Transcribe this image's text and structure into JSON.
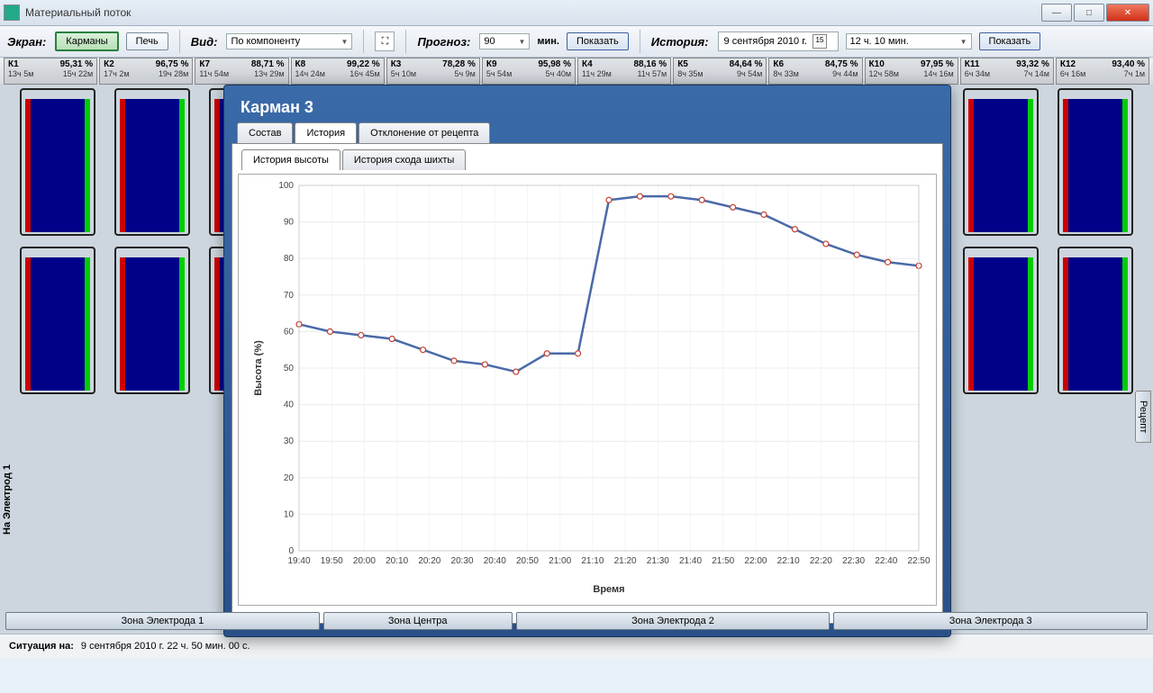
{
  "window": {
    "title": "Материальный поток"
  },
  "toolbar": {
    "screen_label": "Экран:",
    "pockets_btn": "Карманы",
    "furnace_btn": "Печь",
    "view_label": "Вид:",
    "view_value": "По компоненту",
    "forecast_label": "Прогноз:",
    "forecast_value": "90",
    "forecast_unit": "мин.",
    "show_btn": "Показать",
    "history_label": "История:",
    "history_date": "9 сентября 2010 г.",
    "history_time": "12 ч. 10 мин.",
    "show_btn2": "Показать"
  },
  "pockets": [
    {
      "name": "К1",
      "pct": "95,31 %",
      "t1": "13ч 5м",
      "t2": "15ч 22м"
    },
    {
      "name": "К2",
      "pct": "96,75 %",
      "t1": "17ч 2м",
      "t2": "19ч 28м"
    },
    {
      "name": "К7",
      "pct": "88,71 %",
      "t1": "11ч 54м",
      "t2": "13ч 29м"
    },
    {
      "name": "К8",
      "pct": "99,22 %",
      "t1": "14ч 24м",
      "t2": "16ч 45м"
    },
    {
      "name": "К3",
      "pct": "78,28 %",
      "t1": "5ч 10м",
      "t2": "5ч 9м"
    },
    {
      "name": "К9",
      "pct": "95,98 %",
      "t1": "5ч 54м",
      "t2": "5ч 40м"
    },
    {
      "name": "К4",
      "pct": "88,16 %",
      "t1": "11ч 29м",
      "t2": "11ч 57м"
    },
    {
      "name": "К5",
      "pct": "84,64 %",
      "t1": "8ч 35м",
      "t2": "9ч 54м"
    },
    {
      "name": "К6",
      "pct": "84,75 %",
      "t1": "8ч 33м",
      "t2": "9ч 44м"
    },
    {
      "name": "К10",
      "pct": "97,95 %",
      "t1": "12ч 58м",
      "t2": "14ч 16м"
    },
    {
      "name": "К11",
      "pct": "93,32 %",
      "t1": "6ч 34м",
      "t2": "7ч 14м"
    },
    {
      "name": "К12",
      "pct": "93,40 %",
      "t1": "6ч 16м",
      "t2": "7ч 1м"
    }
  ],
  "popup": {
    "title": "Карман 3",
    "tabs": {
      "composition": "Состав",
      "history": "История",
      "deviation": "Отклонение от рецепта"
    },
    "subtabs": {
      "height": "История высоты",
      "descent": "История схода шихты"
    }
  },
  "vlabel": "На Электрод 1",
  "recipe_tab": "Рецепт",
  "zones": {
    "z1": "Зона Электрода 1",
    "zc": "Зона Центра",
    "z2": "Зона Электрода 2",
    "z3": "Зона Электрода 3"
  },
  "status": {
    "label": "Ситуация на:",
    "value": "9 сентября 2010 г.  22 ч. 50 мин. 00 с."
  },
  "chart_data": {
    "type": "line",
    "title": "",
    "xlabel": "Время",
    "ylabel": "Высота (%)",
    "ylim": [
      0,
      100
    ],
    "x": [
      "19:40",
      "19:50",
      "20:00",
      "20:10",
      "20:20",
      "20:30",
      "20:40",
      "20:50",
      "21:00",
      "21:10",
      "21:20",
      "21:30",
      "21:40",
      "21:50",
      "22:00",
      "22:10",
      "22:20",
      "22:30",
      "22:40",
      "22:50"
    ],
    "values": [
      62,
      60,
      59,
      58,
      55,
      52,
      51,
      49,
      54,
      54,
      96,
      97,
      97,
      96,
      94,
      92,
      88,
      84,
      81,
      79,
      78
    ]
  }
}
